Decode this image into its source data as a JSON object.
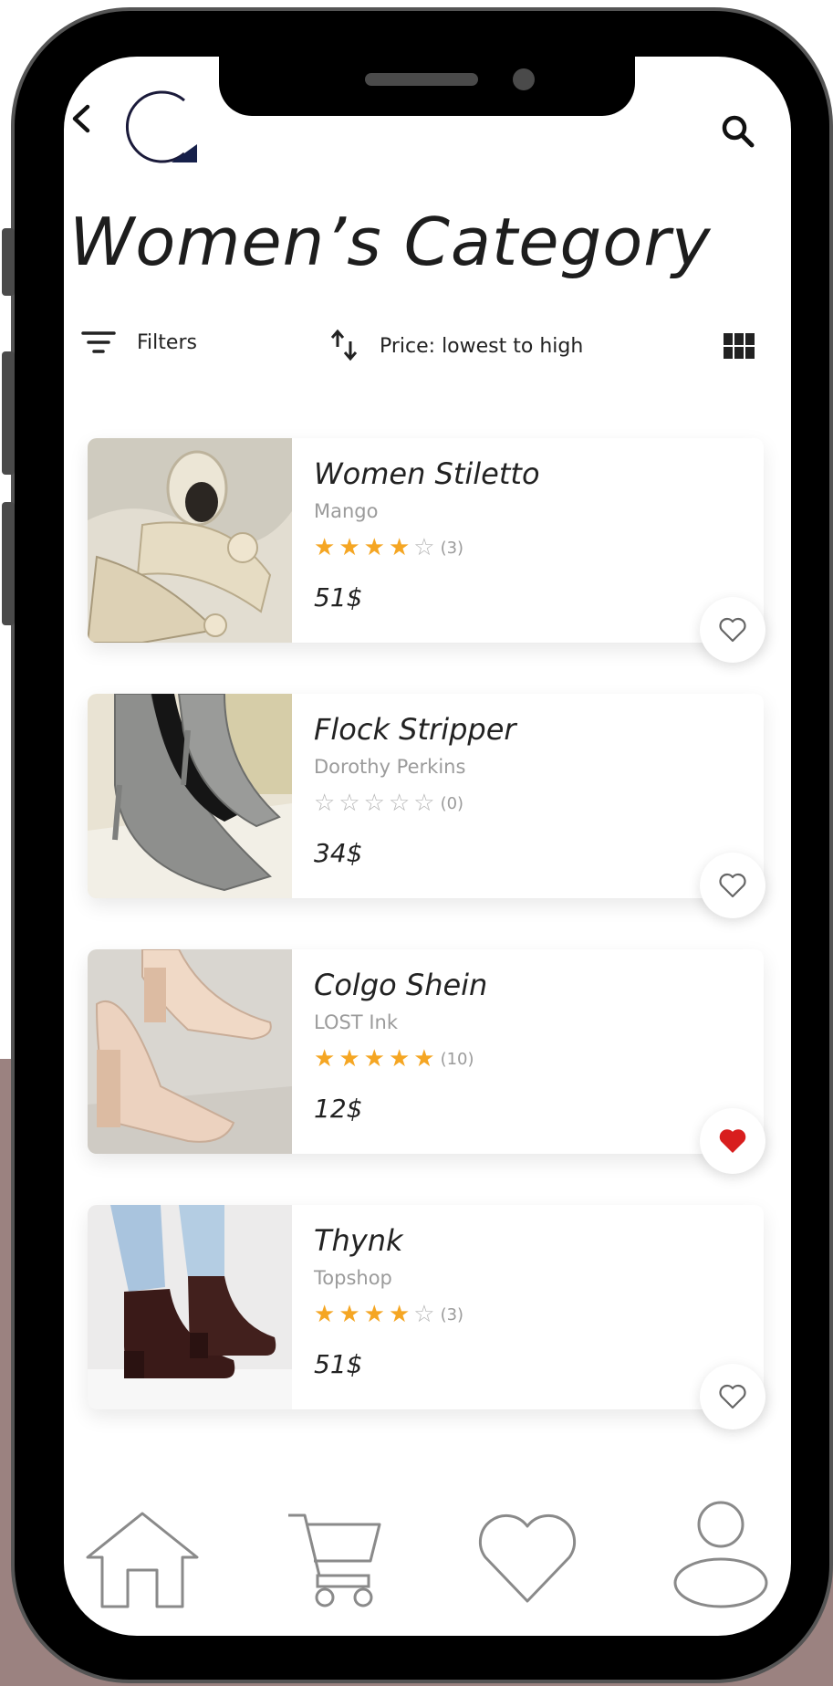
{
  "header": {
    "title": "Women’s  Category"
  },
  "toolbar": {
    "filters_label": "Filters",
    "sort_label": "Price: lowest to high"
  },
  "products": [
    {
      "name": "Women Stiletto",
      "brand": "Mango",
      "rating": 4,
      "count": "(3)",
      "price": "51$",
      "favorited": false
    },
    {
      "name": "Flock Stripper",
      "brand": "Dorothy Perkins",
      "rating": 0,
      "count": "(0)",
      "price": "34$",
      "favorited": false
    },
    {
      "name": "Colgo Shein",
      "brand": "LOST Ink",
      "rating": 5,
      "count": "(10)",
      "price": "12$",
      "favorited": true
    },
    {
      "name": "Thynk",
      "brand": "Topshop",
      "rating": 4,
      "count": "(3)",
      "price": "51$",
      "favorited": false
    }
  ],
  "bottom_nav": [
    {
      "icon": "home-icon"
    },
    {
      "icon": "cart-icon"
    },
    {
      "icon": "heart-icon"
    },
    {
      "icon": "profile-icon"
    }
  ],
  "colors": {
    "star": "#f5a623",
    "favorite_active": "#d81e1e",
    "backdrop": "#9b8280"
  }
}
